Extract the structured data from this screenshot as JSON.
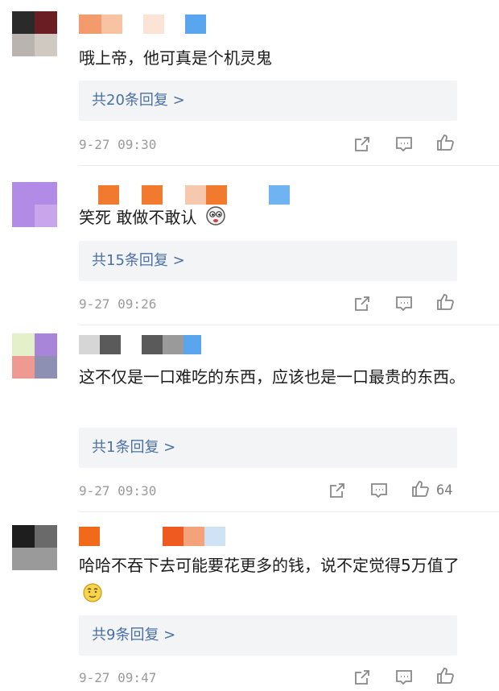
{
  "comments": [
    {
      "text": "哦上帝，他可真是个机灵鬼",
      "replies": "共20条回复 >",
      "time": "9-27 09:30",
      "likes": ""
    },
    {
      "text": "笑死 敢做不敢认",
      "replies": "共15条回复 >",
      "time": "9-27 09:26",
      "likes": ""
    },
    {
      "text": "这不仅是一口难吃的东西，应该也是一口最贵的东西。",
      "replies": "共1条回复 >",
      "time": "9-27 09:30",
      "likes": "64"
    },
    {
      "text": "哈哈不吞下去可能要花更多的钱，说不定觉得5万值了",
      "replies": "共9条回复 >",
      "time": "9-27 09:47",
      "likes": ""
    }
  ],
  "icons": {
    "share": "share-icon",
    "reply": "comment-icon",
    "like": "thumbs-up-icon"
  },
  "colors": {
    "reply_link": "#4a6fa5",
    "reply_bg": "#f3f4f6",
    "meta": "#9a9a9a"
  }
}
